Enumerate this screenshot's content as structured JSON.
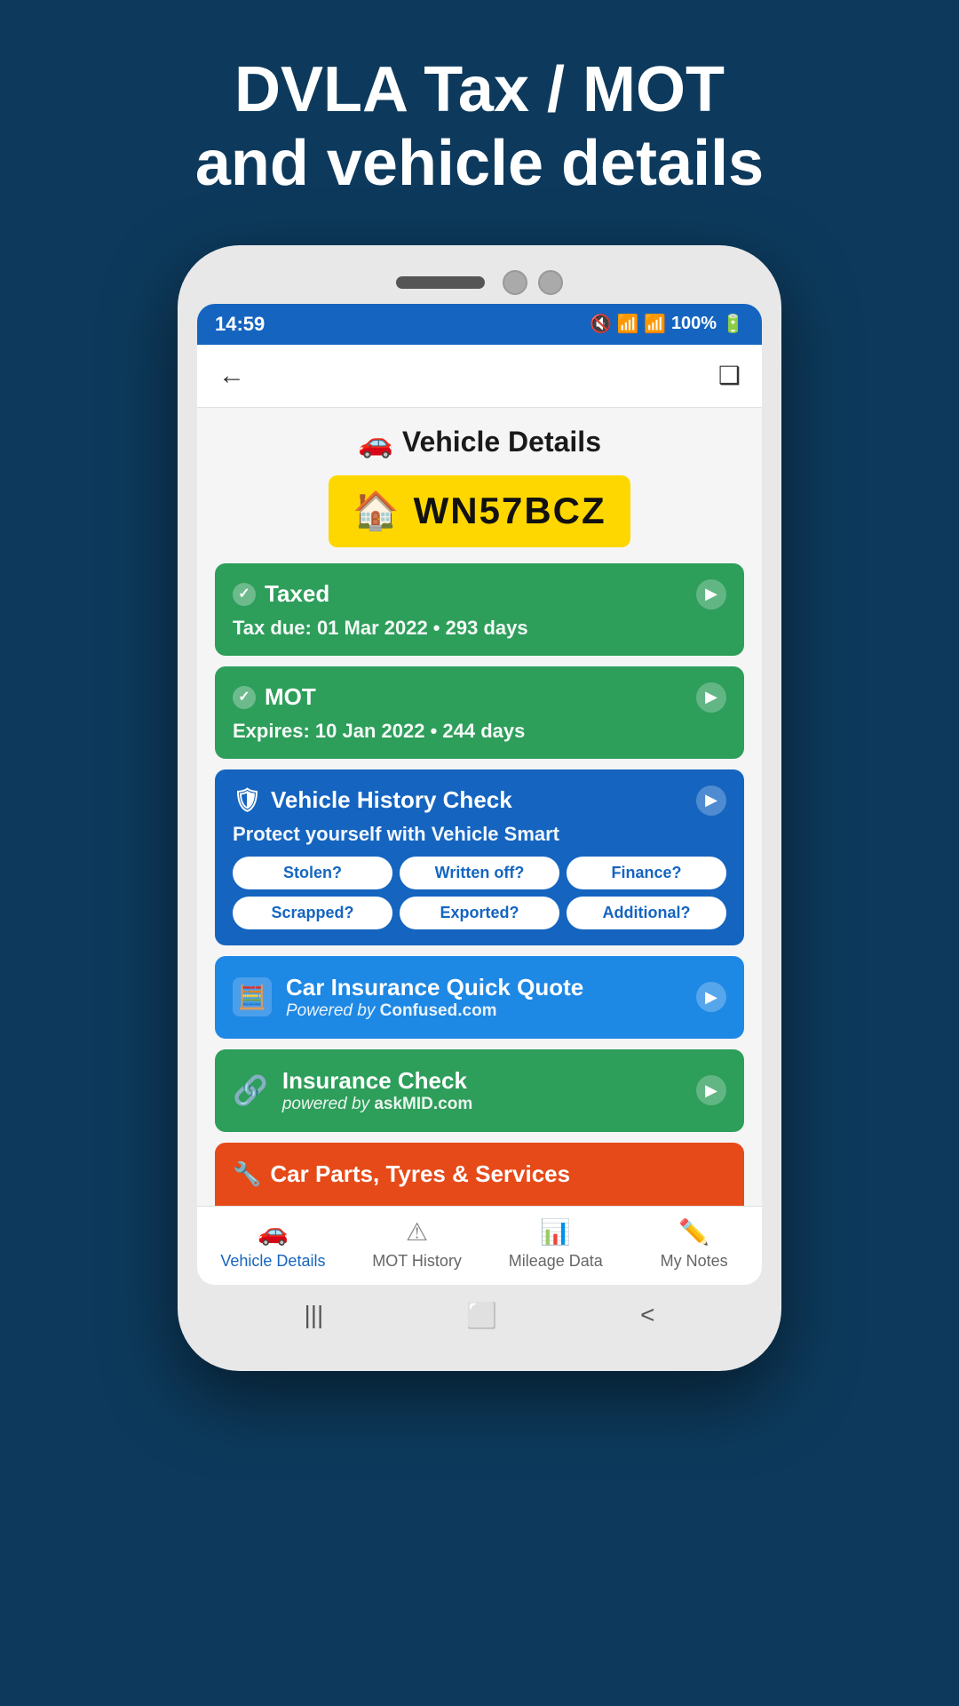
{
  "hero": {
    "title": "DVLA Tax / MOT\nand vehicle details"
  },
  "statusBar": {
    "time": "14:59",
    "battery": "100%",
    "signal": "📶"
  },
  "pageTitle": "Vehicle Details",
  "licensePlate": "WN57BCZ",
  "cards": {
    "taxed": {
      "title": "Taxed",
      "subtitle": "Tax due: 01 Mar 2022 • 293 days"
    },
    "mot": {
      "title": "MOT",
      "subtitle": "Expires: 10 Jan 2022 • 244 days"
    },
    "historyCheck": {
      "title": "Vehicle History Check",
      "subtitle": "Protect yourself with Vehicle Smart",
      "badges": [
        "Stolen?",
        "Written off?",
        "Finance?",
        "Scrapped?",
        "Exported?",
        "Additional?"
      ]
    },
    "insurance": {
      "title": "Car Insurance Quick Quote",
      "poweredBy": "Powered by",
      "brand": "Confused.com"
    },
    "insuranceCheck": {
      "title": "Insurance Check",
      "poweredBy": "powered by",
      "brand": "askMID.com"
    },
    "carParts": {
      "title": "Car Parts, Tyres & Services"
    }
  },
  "bottomNav": {
    "items": [
      {
        "label": "Vehicle Details",
        "active": true
      },
      {
        "label": "MOT History",
        "active": false
      },
      {
        "label": "Mileage Data",
        "active": false
      },
      {
        "label": "My Notes",
        "active": false
      }
    ]
  },
  "colors": {
    "background": "#0d3a5c",
    "statusBar": "#1565c0",
    "green": "#2e9e5b",
    "blueDark": "#1565c0",
    "blueMedium": "#1e88e5",
    "orange": "#e64a19",
    "plateYellow": "#FFD700"
  }
}
